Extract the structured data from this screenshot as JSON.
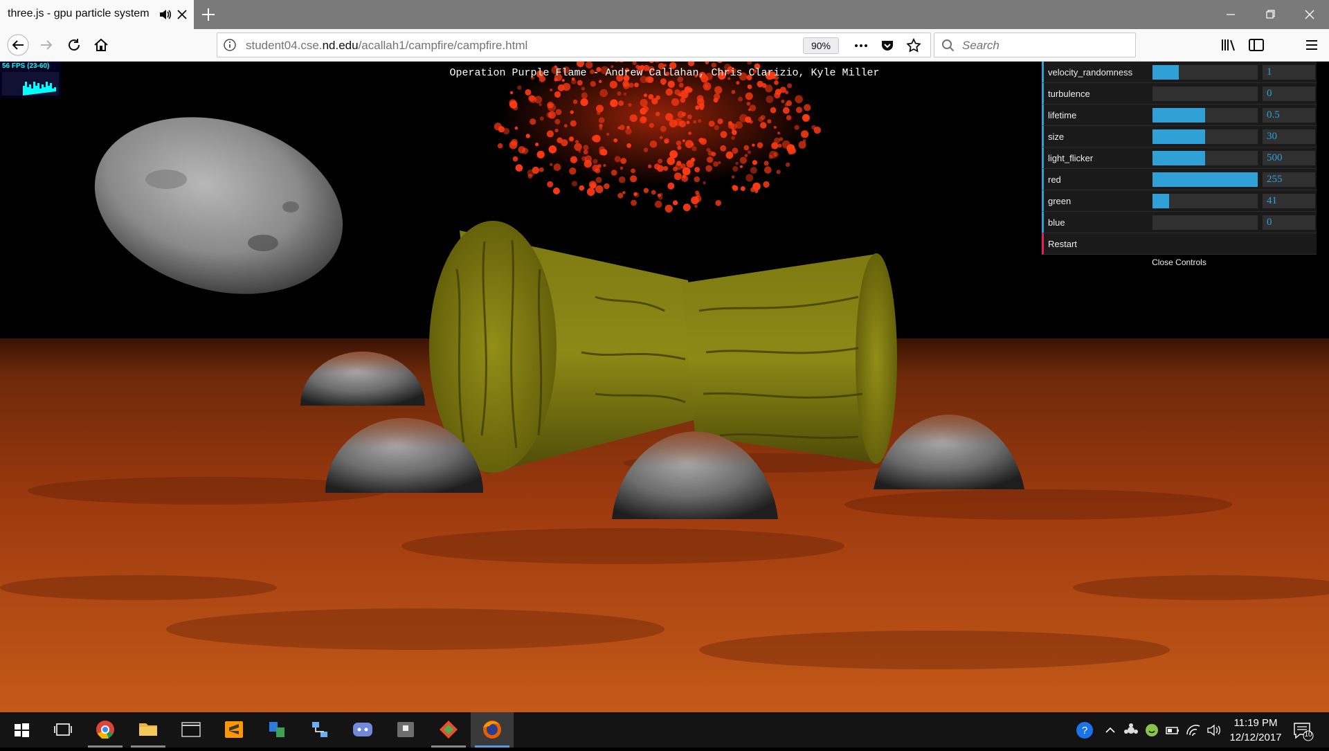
{
  "browser": {
    "tab_title": "three.js - gpu particle system",
    "url_host_prefix": "student04.cse.",
    "url_host_domain": "nd.edu",
    "url_path": "/acallah1/campfire/campfire.html",
    "zoom": "90%",
    "search_placeholder": "Search"
  },
  "page": {
    "title": "Operation Purple Flame - Andrew Callahan, Chris Clarizio, Kyle Miller",
    "fps_label": "56 FPS (23-60)"
  },
  "controls": {
    "items": [
      {
        "name": "velocity_randomness",
        "value": "1",
        "fill": 0.25
      },
      {
        "name": "turbulence",
        "value": "0",
        "fill": 0.0
      },
      {
        "name": "lifetime",
        "value": "0.5",
        "fill": 0.5
      },
      {
        "name": "size",
        "value": "30",
        "fill": 0.5
      },
      {
        "name": "light_flicker",
        "value": "500",
        "fill": 0.5
      },
      {
        "name": "red",
        "value": "255",
        "fill": 1.0
      },
      {
        "name": "green",
        "value": "41",
        "fill": 0.16
      },
      {
        "name": "blue",
        "value": "0",
        "fill": 0.0
      }
    ],
    "restart_label": "Restart",
    "close_label": "Close Controls"
  },
  "taskbar": {
    "time": "11:19 PM",
    "date": "12/12/2017",
    "notifications_count": "10"
  },
  "colors": {
    "gui_accent": "#2fa1d6",
    "restart_accent": "#e61d5f",
    "ground": "#b5440f",
    "log": "#8a8410"
  }
}
